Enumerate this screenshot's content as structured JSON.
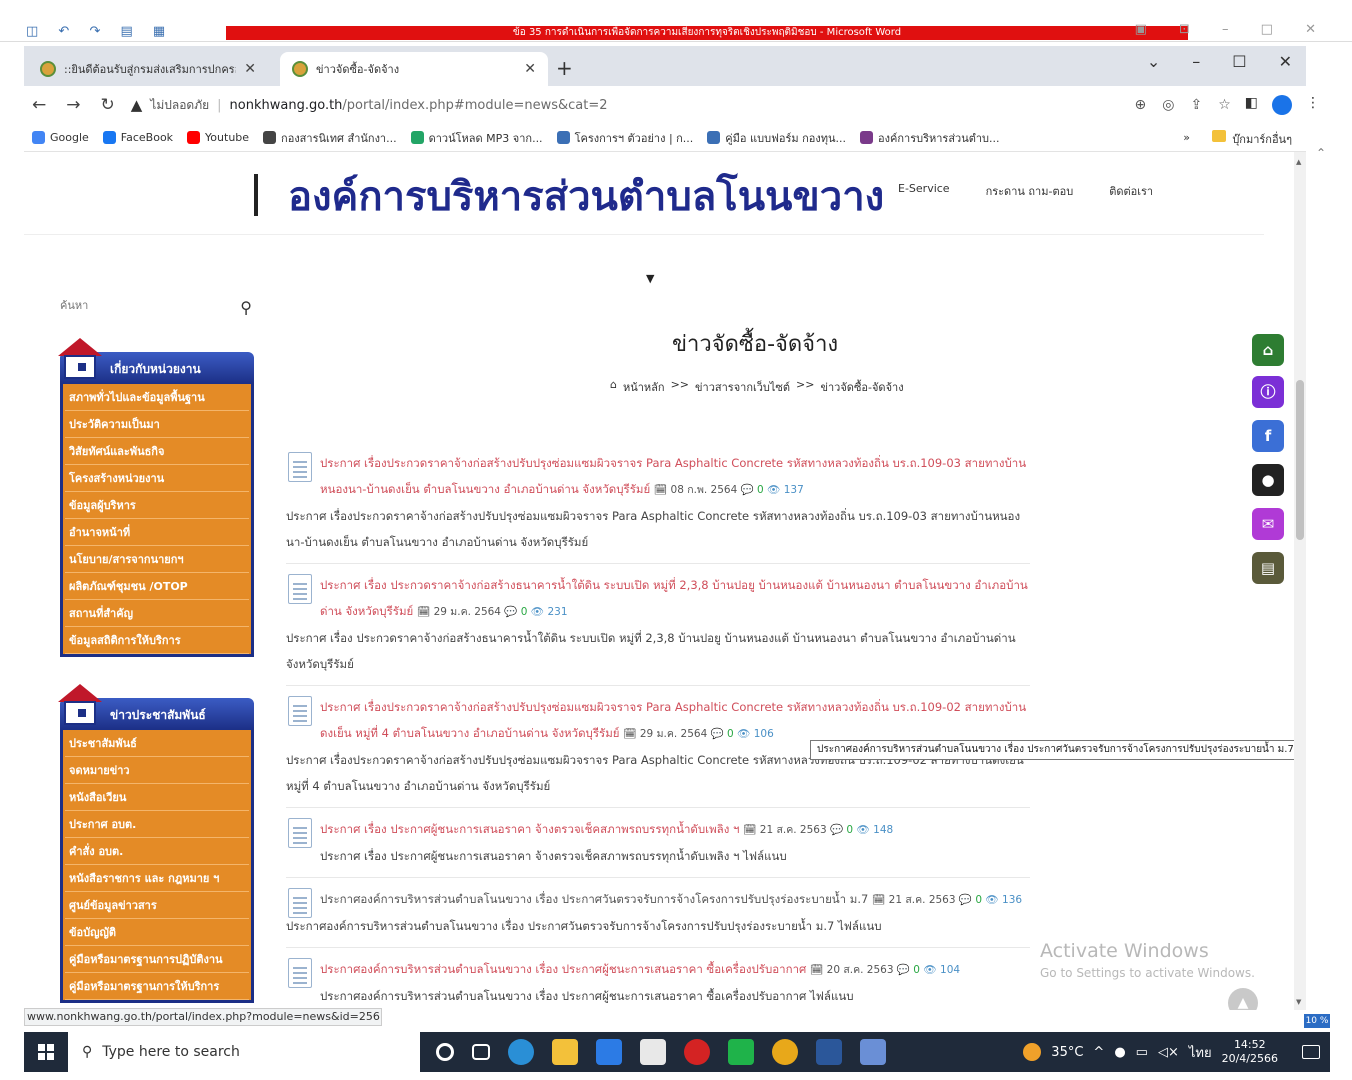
{
  "word": {
    "title": "ข้อ 35 การดำเนินการเพื่อจัดการความเสี่ยงการทุจริตเชิงประพฤติมิชอบ - Microsoft Word"
  },
  "browser": {
    "tabs": [
      {
        "label": "::ยินดีต้อนรับสู่กรมส่งเสริมการปกครอง"
      },
      {
        "label": "ข่าวจัดซื้อ-จัดจ้าง"
      }
    ],
    "security_label": "ไม่ปลอดภัย",
    "url_host": "nonkhwang.go.th",
    "url_path": "/portal/index.php#module=news&cat=2",
    "bookmarks": [
      {
        "label": "Google",
        "color": "#4285f4"
      },
      {
        "label": "FaceBook",
        "color": "#1877f2"
      },
      {
        "label": "Youtube",
        "color": "#ff0000"
      },
      {
        "label": "กองสารนิเทศ สำนักงา...",
        "color": "#444444"
      },
      {
        "label": "ดาวน์โหลด MP3 จาก...",
        "color": "#23a566"
      },
      {
        "label": "โครงการฯ ตัวอย่าง | ก...",
        "color": "#3b6fb5"
      },
      {
        "label": "คู่มือ แบบฟอร์ม กองทุน...",
        "color": "#3b6fb5"
      },
      {
        "label": "องค์การบริหารส่วนตำบ...",
        "color": "#7a3a8a"
      }
    ],
    "bookmarks_more": "»",
    "other_bookmarks": "บุ๊กมาร์กอื่นๆ",
    "status_url": "www.nonkhwang.go.th/portal/index.php?module=news&id=256",
    "tooltip": "ประกาศองค์การบริหารส่วนตำบลโนนขวาง เรื่อง ประกาศวันตรวจรับการจ้างโครงการปรับปรุงร่องระบายน้ำ ม.7"
  },
  "site": {
    "brand": "องค์การบริหารส่วนตำบลโนนขวาง",
    "topnav": [
      "E-Service",
      "กระดาน ถาม-ตอบ",
      "ติดต่อเรา"
    ],
    "search_placeholder": "ค้นหา",
    "page_title": "ข่าวจัดซื้อ-จัดจ้าง",
    "breadcrumb": [
      "หน้าหลัก",
      ">>",
      "ข่าวสารจากเว็บไซต์",
      ">>",
      "ข่าวจัดซื้อ-จัดจ้าง"
    ]
  },
  "menus": [
    {
      "title": "เกี่ยวกับหน่วยงาน",
      "items": [
        "สภาพทั่วไปและข้อมูลพื้นฐาน",
        "ประวัติความเป็นมา",
        "วิสัยทัศน์และพันธกิจ",
        "โครงสร้างหน่วยงาน",
        "ข้อมูลผู้บริหาร",
        "อำนาจหน้าที่",
        "นโยบาย/สารจากนายกฯ",
        "ผลิตภัณฑ์ชุมชน /OTOP",
        "สถานที่สำคัญ",
        "ข้อมูลสถิติการให้บริการ"
      ]
    },
    {
      "title": "ข่าวประชาสัมพันธ์",
      "items": [
        "ประชาสัมพันธ์",
        "จดหมายข่าว",
        "หนังสือเวียน",
        "ประกาศ อบต.",
        "คำสั่ง อบต.",
        "หนังสือราชการ และ กฎหมาย ฯ",
        "ศูนย์ข้อมูลข่าวสาร",
        "ข้อบัญญัติ",
        "คู่มือหรือมาตรฐานการปฏิบัติงาน",
        "คู่มือหรือมาตรฐานการให้บริการ"
      ]
    }
  ],
  "news": [
    {
      "title": "ประกาศ เรื่องประกวดราคาจ้างก่อสร้างปรับปรุงซ่อมแซมผิวจราจร Para Asphaltic Concrete รหัสทางหลวงท้องถิ่น บร.ถ.109-03 สายทางบ้านหนองนา-บ้านดงเย็น ตำบลโนนขวาง อำเภอบ้านด่าน จังหวัดบุรีรัมย์",
      "date": "08 ก.พ. 2564",
      "comments": "0",
      "views": "137",
      "desc": "ประกาศ เรื่องประกวดราคาจ้างก่อสร้างปรับปรุงซ่อมแซมผิวจราจร Para Asphaltic Concrete รหัสทางหลวงท้องถิ่น บร.ถ.109-03 สายทางบ้านหนองนา-บ้านดงเย็น ตำบลโนนขวาง อำเภอบ้านด่าน จังหวัดบุรีรัมย์"
    },
    {
      "title": "ประกาศ เรื่อง ประกวดราคาจ้างก่อสร้างธนาคารน้ำใต้ดิน ระบบเปิด หมู่ที่ 2,3,8 บ้านปอยู บ้านหนองแต้ บ้านหนองนา ตำบลโนนขวาง อำเภอบ้านด่าน จังหวัดบุรีรัมย์",
      "date": "29 ม.ค. 2564",
      "comments": "0",
      "views": "231",
      "desc": "ประกาศ เรื่อง ประกวดราคาจ้างก่อสร้างธนาคารน้ำใต้ดิน ระบบเปิด หมู่ที่ 2,3,8 บ้านปอยู บ้านหนองแต้ บ้านหนองนา ตำบลโนนขวาง อำเภอบ้านด่าน จังหวัดบุรีรัมย์"
    },
    {
      "title": "ประกาศ เรื่องประกวดราคาจ้างก่อสร้างปรับปรุงซ่อมแซมผิวจราจร Para Asphaltic Concrete รหัสทางหลวงท้องถิ่น บร.ถ.109-02 สายทางบ้านดงเย็น หมู่ที่ 4 ตำบลโนนขวาง อำเภอบ้านด่าน จังหวัดบุรีรัมย์",
      "date": "29 ม.ค. 2564",
      "comments": "0",
      "views": "106",
      "desc": "ประกาศ เรื่องประกวดราคาจ้างก่อสร้างปรับปรุงซ่อมแซมผิวจราจร Para Asphaltic Concrete รหัสทางหลวงท้องถิ่น บร.ถ.109-02 สายทางบ้านดงเย็น หมู่ที่ 4 ตำบลโนนขวาง อำเภอบ้านด่าน จังหวัดบุรีรัมย์"
    },
    {
      "title": "ประกาศ เรื่อง ประกาศผู้ชนะการเสนอราคา จ้างตรวจเช็คสภาพรถบรรทุกน้ำดับเพลิง ฯ",
      "date": "21 ส.ค. 2563",
      "comments": "0",
      "views": "148",
      "desc": "ประกาศ เรื่อง ประกาศผู้ชนะการเสนอราคา จ้างตรวจเช็คสภาพรถบรรทุกน้ำดับเพลิง ฯ ไฟล์แนบ"
    },
    {
      "title": "ประกาศองค์การบริหารส่วนตำบลโนนขวาง เรื่อง ประกาศวันตรวจรับการจ้างโครงการปรับปรุงร่องระบายน้ำ ม.7",
      "date": "21 ส.ค. 2563",
      "comments": "0",
      "views": "136",
      "desc": "ประกาศองค์การบริหารส่วนตำบลโนนขวาง เรื่อง ประกาศวันตรวจรับการจ้างโครงการปรับปรุงร่องระบายน้ำ ม.7 ไฟล์แนบ"
    },
    {
      "title": "ประกาศองค์การบริหารส่วนตำบลโนนขวาง เรื่อง ประกาศผู้ชนะการเสนอราคา ซื้อเครื่องปรับอากาศ",
      "date": "20 ส.ค. 2563",
      "comments": "0",
      "views": "104",
      "desc": "ประกาศองค์การบริหารส่วนตำบลโนนขวาง เรื่อง ประกาศผู้ชนะการเสนอราคา ซื้อเครื่องปรับอากาศ ไฟล์แนบ"
    }
  ],
  "float_icons": [
    {
      "name": "home-icon",
      "glyph": "⌂",
      "color": "#2e7d32"
    },
    {
      "name": "info-icon",
      "glyph": "ⓘ",
      "color": "#7b2fd6"
    },
    {
      "name": "facebook-icon",
      "glyph": "f",
      "color": "#3b6fd6"
    },
    {
      "name": "user-icon",
      "glyph": "●",
      "color": "#222222"
    },
    {
      "name": "mail-icon",
      "glyph": "✉",
      "color": "#b03ad6"
    },
    {
      "name": "chart-icon",
      "glyph": "▤",
      "color": "#5a5a3a"
    }
  ],
  "activate": {
    "line1": "Activate Windows",
    "line2": "Go to Settings to activate Windows."
  },
  "zoom_chip": "10 %",
  "taskbar": {
    "search_placeholder": "Type here to search",
    "temperature": "35°C",
    "language": "ไทย",
    "time": "14:52",
    "date": "20/4/2566"
  }
}
